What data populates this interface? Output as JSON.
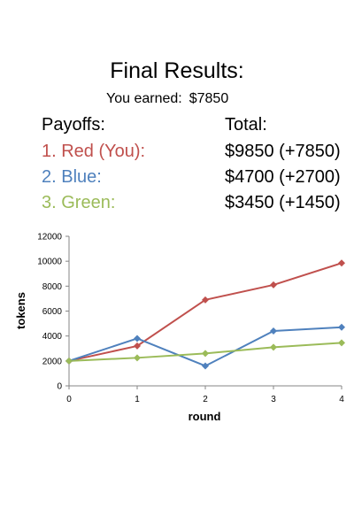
{
  "header": {
    "title": "Final Results:"
  },
  "earnings": {
    "label": "You earned:",
    "amount": "$7850"
  },
  "payoffs": {
    "header_left": "Payoffs:",
    "header_right": "Total:",
    "rows": [
      {
        "rank_name": "1. Red (You):",
        "total": "$9850 (+7850)",
        "color": "#c0504d"
      },
      {
        "rank_name": "2. Blue:",
        "total": "$4700 (+2700)",
        "color": "#4f81bd"
      },
      {
        "rank_name": "3. Green:",
        "total": "$3450 (+1450)",
        "color": "#9bbb59"
      }
    ]
  },
  "chart_data": {
    "type": "line",
    "xlabel": "round",
    "ylabel": "tokens",
    "x": [
      0,
      1,
      2,
      3,
      4
    ],
    "xticks": [
      "0",
      "1",
      "2",
      "3",
      "4"
    ],
    "yticks": [
      "0",
      "2000",
      "4000",
      "6000",
      "8000",
      "10000",
      "12000"
    ],
    "ylim": [
      0,
      12000
    ],
    "grid": false,
    "legend": "none",
    "series": [
      {
        "values": [
          2000,
          3200,
          6900,
          8100,
          9850
        ],
        "color": "#c0504d"
      },
      {
        "values": [
          2000,
          3800,
          1600,
          4400,
          4700
        ],
        "color": "#4f81bd"
      },
      {
        "values": [
          2000,
          2250,
          2600,
          3100,
          3450
        ],
        "color": "#9bbb59"
      }
    ]
  }
}
